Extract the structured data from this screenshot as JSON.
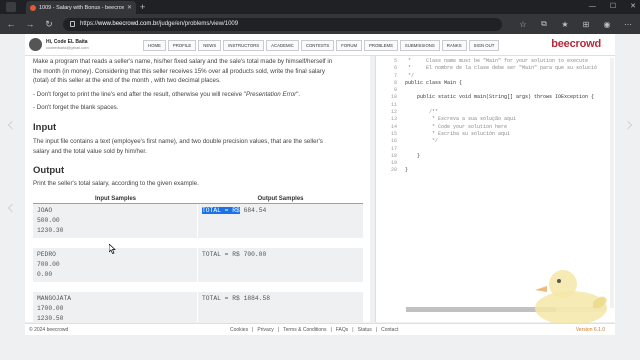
{
  "browser": {
    "tab_title": "1009 - Salary with Bonus - beecrowd",
    "url_prefix": "https://",
    "url_domain": "www.beecrowd.com.br",
    "url_path": "/judge/en/problems/view/1009"
  },
  "header": {
    "user_name": "Hi, Code EL Baita",
    "user_email": "codeelbaita@gmail.com",
    "nav": [
      "HOME",
      "PROFILE",
      "NEWS",
      "INSTRUCTORS",
      "ACADEMIC",
      "CONTESTS",
      "FORUM",
      "PROBLEMS",
      "SUBMISSIONS",
      "RANKS",
      "SIGN OUT"
    ],
    "logo": "beecrowd"
  },
  "problem": {
    "description_lines": [
      "Make a program that reads a seller's name, his/her fixed salary and the sale's total made by himself/herself in",
      "the month (in money). Considering that this seller receives 15% over all products sold, write the final salary",
      "(total) of this seller at the end of the month , with two decimal places."
    ],
    "note1_prefix": "- Don't forget to print the line's end after the result, otherwise you will receive \"",
    "note1_em": "Presentation Error",
    "note1_suffix": "\".",
    "note2": "- Don't forget the blank spaces.",
    "input_heading": "Input",
    "input_lines": [
      "The input file contains a text (employee's first name), and two double precision values, that are the seller's",
      "salary and the total value sold by him/her."
    ],
    "output_heading": "Output",
    "output_text": "Print the seller's total salary, according to the given example."
  },
  "samples": {
    "input_header": "Input Samples",
    "output_header": "Output Samples",
    "rows": [
      {
        "input": "JOAO\n500.00\n1230.30",
        "output_selected": "TOTAL = R$",
        "output_rest": " 684.54"
      },
      {
        "input": "PEDRO\n700.00\n0.00",
        "output_selected": "",
        "output_rest": "TOTAL = R$ 700.00"
      },
      {
        "input": "MANGOJATA\n1700.00\n1230.50",
        "output_selected": "",
        "output_rest": "TOTAL = R$ 1884.58"
      }
    ]
  },
  "editor": {
    "lines": [
      {
        "n": "5",
        "t": " *     Class name must be \"Main\" for your solution to execute",
        "c": true
      },
      {
        "n": "6",
        "t": " *     El nombre de la clase debe ser \"Main\" para que su solució",
        "c": true
      },
      {
        "n": "7",
        "t": " */",
        "c": true
      },
      {
        "n": "8",
        "t": "public class Main {",
        "c": false
      },
      {
        "n": "9",
        "t": "",
        "c": false
      },
      {
        "n": "10",
        "t": "    public static void main(String[] args) throws IOException {",
        "c": false
      },
      {
        "n": "11",
        "t": "",
        "c": false
      },
      {
        "n": "12",
        "t": "        /**",
        "c": true
      },
      {
        "n": "13",
        "t": "         * Escreva a sua solução aqui",
        "c": true
      },
      {
        "n": "14",
        "t": "         * Code your solution here",
        "c": true
      },
      {
        "n": "15",
        "t": "         * Escriba su solución aquí",
        "c": true
      },
      {
        "n": "16",
        "t": "         */",
        "c": true
      },
      {
        "n": "17",
        "t": "",
        "c": false
      },
      {
        "n": "18",
        "t": "    }",
        "c": false
      },
      {
        "n": "19",
        "t": "",
        "c": false
      },
      {
        "n": "20",
        "t": "}",
        "c": false
      }
    ]
  },
  "footer": {
    "copyright": "© 2024 beecrowd",
    "links": [
      "Cookies",
      "|",
      "Privacy",
      "|",
      "Terms & Conditions",
      "|",
      "FAQs",
      "|",
      "Status",
      "|",
      "Contact"
    ],
    "version": "Version 6.1.0"
  },
  "colors": {
    "brand": "#b52b3a",
    "selection": "#1a73e8"
  }
}
